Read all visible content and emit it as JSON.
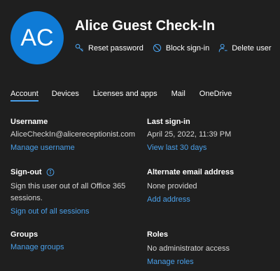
{
  "user": {
    "initials": "AC",
    "title": "Alice Guest Check-In",
    "avatar_color": "#0f7bd6"
  },
  "actions": [
    {
      "label": "Reset password",
      "icon": "key-icon"
    },
    {
      "label": "Block sign-in",
      "icon": "block-icon"
    },
    {
      "label": "Delete user",
      "icon": "person-delete-icon"
    }
  ],
  "tabs": [
    {
      "label": "Account",
      "active": true
    },
    {
      "label": "Devices"
    },
    {
      "label": "Licenses and apps"
    },
    {
      "label": "Mail"
    },
    {
      "label": "OneDrive"
    }
  ],
  "username": {
    "heading": "Username",
    "value": "AliceCheckIn@alicereceptionist.com",
    "link": "Manage username"
  },
  "last_signin": {
    "heading": "Last sign-in",
    "value": "April 25, 2022, 11:39 PM",
    "link": "View last 30 days"
  },
  "signout": {
    "heading": "Sign-out",
    "value": "Sign this user out of all Office 365 sessions.",
    "link": "Sign out of all sessions"
  },
  "alt_email": {
    "heading": "Alternate email address",
    "value": "None provided",
    "link": "Add address"
  },
  "groups": {
    "heading": "Groups",
    "link": "Manage groups"
  },
  "roles": {
    "heading": "Roles",
    "value": "No administrator access",
    "link": "Manage roles"
  },
  "colors": {
    "background": "#1f1f1f",
    "link": "#4aa0ea",
    "accent_underline": "#4aa0ea"
  }
}
